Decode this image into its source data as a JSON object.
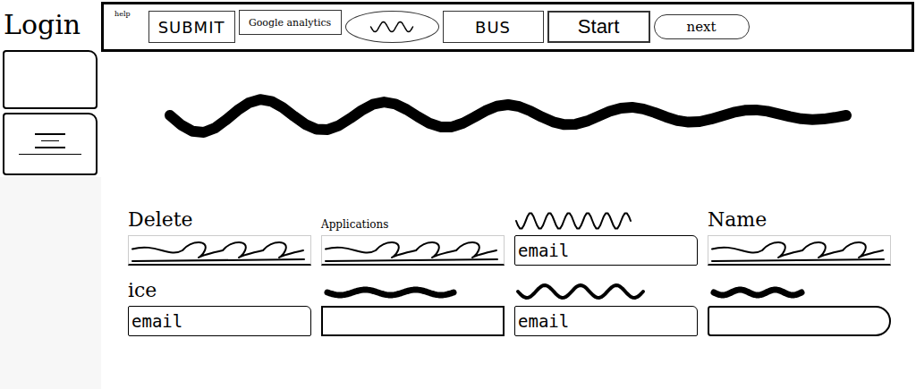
{
  "sidebar": {
    "title": "Login",
    "items": [
      {
        "kind": "box"
      },
      {
        "kind": "text-lines"
      }
    ]
  },
  "toolbar": {
    "caption": "help",
    "buttons": [
      {
        "label": "SUBMIT",
        "kind": "rect"
      },
      {
        "label": "Google analytics",
        "kind": "small"
      },
      {
        "label": "",
        "kind": "squiggle-oval"
      },
      {
        "label": "BUS",
        "kind": "rect"
      },
      {
        "label": "Start",
        "kind": "bold"
      },
      {
        "label": "next",
        "kind": "oval-text"
      }
    ]
  },
  "form": {
    "fields": [
      {
        "label": "Delete",
        "label_kind": "text",
        "input_kind": "scribble",
        "value": ""
      },
      {
        "label": "Applications",
        "label_kind": "small",
        "input_kind": "scribble",
        "value": ""
      },
      {
        "label": "",
        "label_kind": "zigzag",
        "input_kind": "email",
        "value": "email"
      },
      {
        "label": "Name",
        "label_kind": "text",
        "input_kind": "scribble",
        "value": ""
      },
      {
        "label": "ice",
        "label_kind": "text",
        "input_kind": "email",
        "value": "email"
      },
      {
        "label": "",
        "label_kind": "thick-wave",
        "input_kind": "empty",
        "value": ""
      },
      {
        "label": "",
        "label_kind": "wave",
        "input_kind": "email",
        "value": "email"
      },
      {
        "label": "",
        "label_kind": "thick-short",
        "input_kind": "rounded",
        "value": ""
      }
    ]
  }
}
